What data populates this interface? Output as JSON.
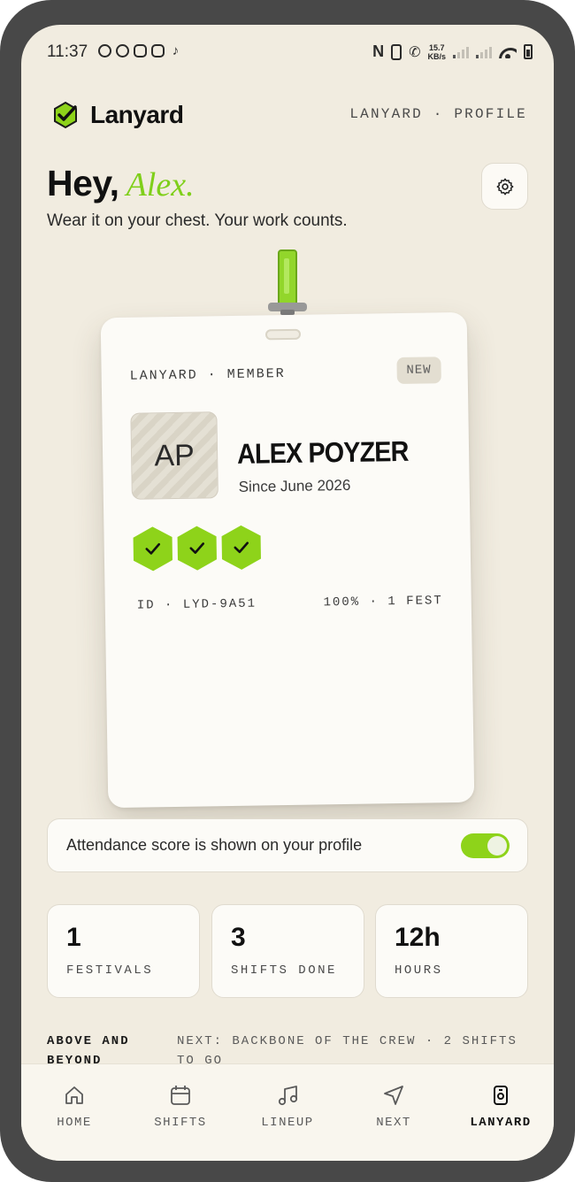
{
  "status_bar": {
    "time": "11:37",
    "speed_value": "15.7",
    "speed_unit": "KB/s"
  },
  "header": {
    "brand": "Lanyard",
    "breadcrumb": "LANYARD · PROFILE",
    "accent": "#8ed31a"
  },
  "greeting": {
    "hey": "Hey,",
    "name": "Alex.",
    "tagline": "Wear it on your chest. Your work counts."
  },
  "badge": {
    "label": "LANYARD · MEMBER",
    "tag": "NEW",
    "initials": "AP",
    "name": "ALEX POYZER",
    "since": "Since June 2026",
    "achievements": [
      "check-hex-icon",
      "check-hex-icon",
      "check-hex-icon"
    ],
    "id": "ID · LYD-9A51",
    "stat": "100% · 1 FEST"
  },
  "toggle": {
    "label": "Attendance score is shown on your profile",
    "on": true
  },
  "stats": [
    {
      "value": "1",
      "label": "FESTIVALS"
    },
    {
      "value": "3",
      "label": "SHIFTS DONE"
    },
    {
      "value": "12h",
      "label": "HOURS"
    }
  ],
  "progress": {
    "title": "ABOVE AND BEYOND",
    "next": "NEXT: BACKBONE OF THE CREW · 2 SHIFTS TO GO"
  },
  "nav": [
    {
      "label": "HOME",
      "icon": "home-icon"
    },
    {
      "label": "SHIFTS",
      "icon": "calendar-icon"
    },
    {
      "label": "LINEUP",
      "icon": "music-note-icon"
    },
    {
      "label": "NEXT",
      "icon": "navigation-arrow-icon"
    },
    {
      "label": "LANYARD",
      "icon": "badge-icon",
      "active": true
    }
  ]
}
